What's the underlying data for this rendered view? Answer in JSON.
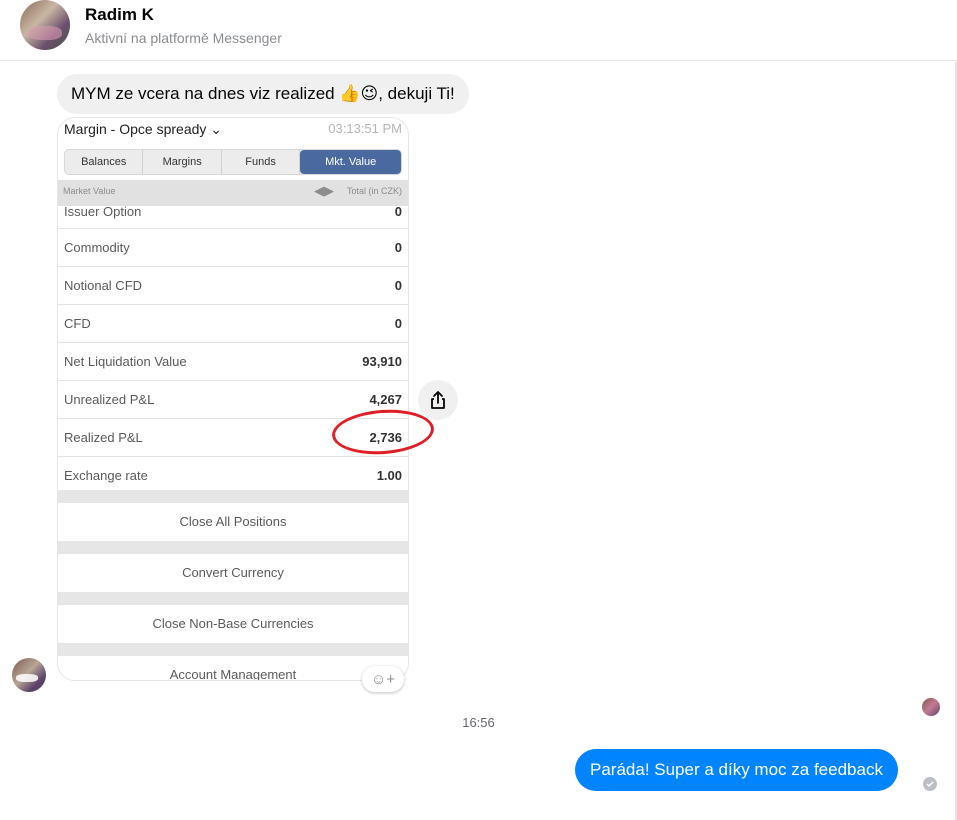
{
  "header": {
    "name": "Radim K",
    "status": "Aktivní na platformě Messenger"
  },
  "messages": {
    "incoming_text": "MYM ze vcera na dnes viz realized",
    "incoming_emoji": "👍😉",
    "incoming_suffix": ", dekuji Ti!",
    "separator_time": "16:56",
    "outgoing_text": "Paráda! Super a díky moc za feedback"
  },
  "screenshot": {
    "title": "Margin - Opce spready",
    "time": "03:13:51 PM",
    "tabs": [
      {
        "label": "Balances",
        "active": false
      },
      {
        "label": "Margins",
        "active": false
      },
      {
        "label": "Funds",
        "active": false
      },
      {
        "label": "Mkt. Value",
        "active": true
      }
    ],
    "table_header_left": "Market Value",
    "table_header_right": "Total (in CZK)",
    "rows": [
      {
        "label": "Issuer Option",
        "value": "0"
      },
      {
        "label": "Commodity",
        "value": "0"
      },
      {
        "label": "Notional CFD",
        "value": "0"
      },
      {
        "label": "CFD",
        "value": "0"
      },
      {
        "label": "Net Liquidation Value",
        "value": "93,910"
      },
      {
        "label": "Unrealized P&L",
        "value": "4,267"
      },
      {
        "label": "Realized P&L",
        "value": "2,736"
      },
      {
        "label": "Exchange rate",
        "value": "1.00"
      }
    ],
    "actions": [
      "Close All Positions",
      "Convert Currency",
      "Close Non-Base Currencies",
      "Account Management"
    ]
  },
  "colors": {
    "accent": "#0084ff",
    "highlight": "#e01e26",
    "tab_active": "#4a6a9f"
  }
}
